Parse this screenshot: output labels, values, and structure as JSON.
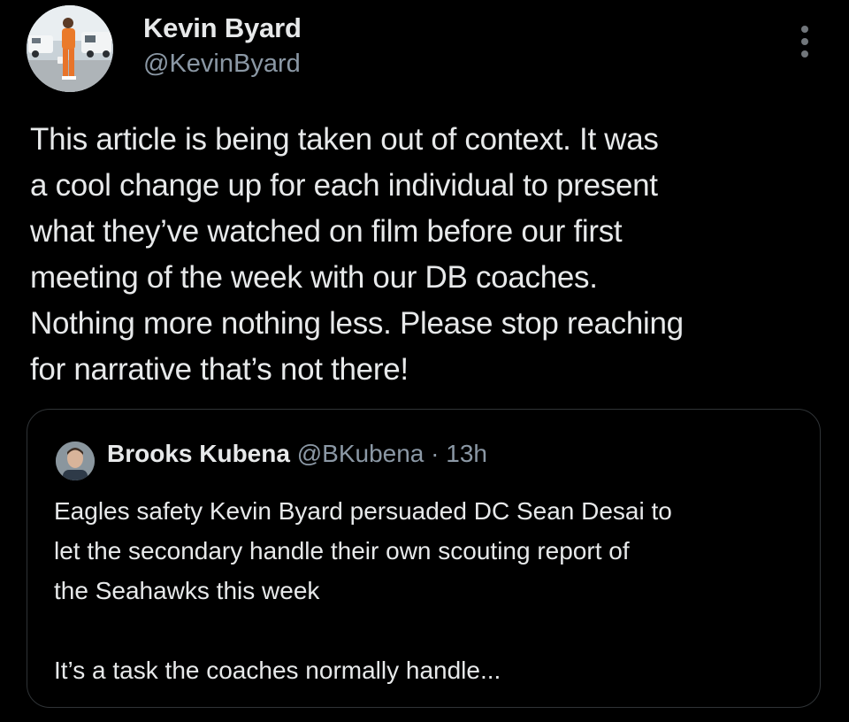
{
  "author": {
    "display_name": "Kevin Byard",
    "handle": "@KevinByard",
    "avatar_icon": "profile-photo-avatar"
  },
  "tweet": {
    "text_lines": [
      "This article is being taken out of context. It was",
      "a cool change up for each individual to present",
      "what they’ve watched on film before our first",
      "meeting of the week with our DB coaches.",
      "Nothing more nothing less. Please stop reaching",
      "for narrative that’s not there!"
    ]
  },
  "more_icon": "more-options-icon",
  "quoted": {
    "display_name": "Brooks Kubena",
    "handle": "@BKubena",
    "separator": "·",
    "time": "13h",
    "text_lines": [
      "Eagles safety Kevin Byard persuaded DC Sean Desai to",
      "let the secondary handle their own scouting report of",
      "the Seahawks this week"
    ],
    "text_lines_2": [
      "It’s a task the coaches normally handle..."
    ]
  },
  "colors": {
    "background": "#000000",
    "primary_text": "#e7e9ea",
    "secondary_text": "#8b98a5",
    "border": "#2f3336"
  }
}
